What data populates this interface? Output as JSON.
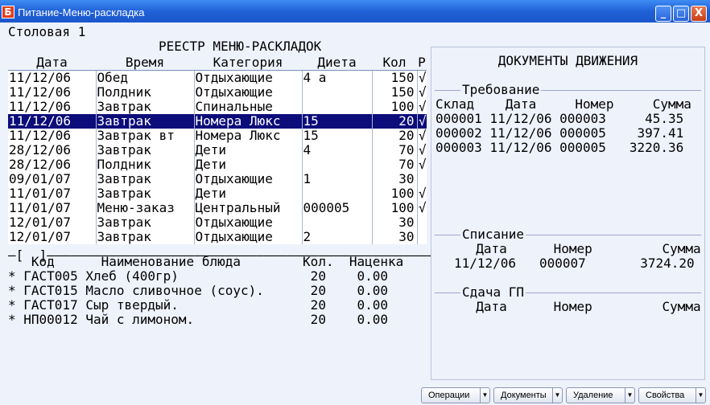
{
  "window": {
    "title": "Питание-Меню-раскладка",
    "icon_letter": "Б",
    "minimize": "_",
    "maximize": "□",
    "close": "X"
  },
  "place": "Столовая 1",
  "registry": {
    "title": "РЕЕСТР МЕНЮ-РАСКЛАДОК",
    "columns": [
      "Дата",
      "Время",
      "Категория",
      "Диета",
      "Кол",
      "Р"
    ],
    "rows": [
      {
        "date": "11/12/06",
        "time": "Обед",
        "category": "Отдыхающие",
        "diet": "4 а",
        "qty": "150",
        "mark": "√"
      },
      {
        "date": "11/12/06",
        "time": "Полдник",
        "category": "Отдыхающие",
        "diet": "",
        "qty": "150",
        "mark": "√"
      },
      {
        "date": "11/12/06",
        "time": "Завтрак",
        "category": "Спинальные",
        "diet": "",
        "qty": "100",
        "mark": "√"
      },
      {
        "date": "11/12/06",
        "time": "Завтрак",
        "category": "Номера Люкс",
        "diet": "15",
        "qty": "20",
        "mark": "√"
      },
      {
        "date": "11/12/06",
        "time": "Завтрак вт",
        "category": "Номера Люкс",
        "diet": "15",
        "qty": "20",
        "mark": "√"
      },
      {
        "date": "28/12/06",
        "time": "Завтрак",
        "category": "Дети",
        "diet": "4",
        "qty": "70",
        "mark": "√"
      },
      {
        "date": "28/12/06",
        "time": "Полдник",
        "category": "Дети",
        "diet": "",
        "qty": "70",
        "mark": "√"
      },
      {
        "date": "09/01/07",
        "time": "Завтрак",
        "category": "Отдыхающие",
        "diet": "1",
        "qty": "30",
        "mark": ""
      },
      {
        "date": "11/01/07",
        "time": "Завтрак",
        "category": "Дети",
        "diet": "",
        "qty": "100",
        "mark": "√"
      },
      {
        "date": "11/01/07",
        "time": "Меню-заказ",
        "category": "Центральный",
        "diet": "000005",
        "qty": "100",
        "mark": "√"
      },
      {
        "date": "12/01/07",
        "time": "Завтрак",
        "category": "Отдыхающие",
        "diet": "",
        "qty": "30",
        "mark": ""
      },
      {
        "date": "12/01/07",
        "time": "Завтрак",
        "category": "Отдыхающие",
        "diet": "2",
        "qty": "30",
        "mark": ""
      }
    ],
    "selected_row": 3
  },
  "divider": "—[  ]———————————————————————————————————————————————————",
  "dishes": {
    "header": "   Код      Наименование блюда        Кол.  Наценка",
    "rows": [
      "* ГАСТ005 Хлеб (400гр)                 20    0.00",
      "* ГАСТ015 Масло сливочное (соус).      20    0.00",
      "* ГАСТ017 Сыр твердый.                 20    0.00",
      "* НП00012 Чай с лимоном.               20    0.00"
    ]
  },
  "movement_docs": {
    "title": "ДОКУМЕНТЫ ДВИЖЕНИЯ",
    "requirement": {
      "label": "Требование",
      "header": "Склад    Дата     Номер     Сумма",
      "rows": [
        "000001 11/12/06 000003     45.35",
        "000002 11/12/06 000005    397.41",
        "000003 11/12/06 000005   3220.36"
      ]
    },
    "writeoff": {
      "label": "Списание",
      "header": "  Дата      Номер         Сумма",
      "row": "11/12/06   000007       3724.20"
    },
    "handover": {
      "label": "Сдача ГП",
      "header": "  Дата      Номер         Сумма"
    }
  },
  "bottom_buttons": [
    {
      "label": "Операции",
      "arrow": "▼"
    },
    {
      "label": "Документы",
      "arrow": "▼"
    },
    {
      "label": "Удаление",
      "arrow": "▼"
    },
    {
      "label": "Свойства",
      "arrow": "▼"
    }
  ]
}
